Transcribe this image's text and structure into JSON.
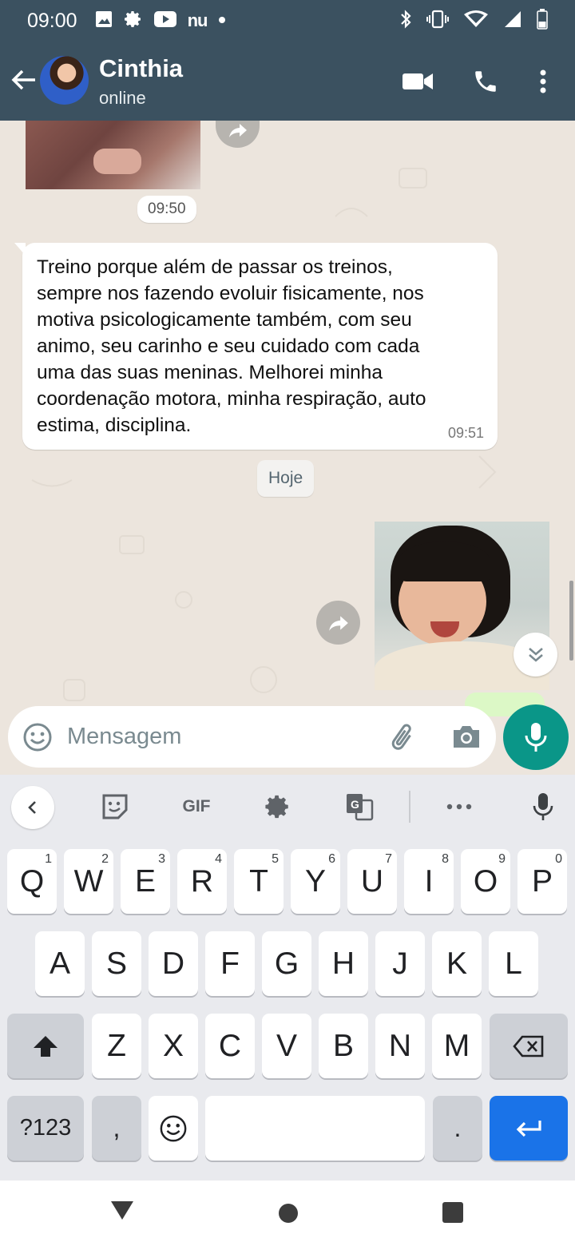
{
  "status_bar": {
    "time": "09:00",
    "left_icons": [
      "gallery-icon",
      "settings-icon",
      "youtube-icon",
      "nubank-icon",
      "dot-icon"
    ],
    "nu_label": "nu",
    "right_icons": [
      "bluetooth-icon",
      "vibrate-icon",
      "wifi-icon",
      "signal-icon",
      "battery-icon"
    ]
  },
  "header": {
    "contact_name": "Cinthia",
    "contact_status": "online",
    "actions": [
      "video-call-icon",
      "voice-call-icon",
      "more-options-icon"
    ]
  },
  "chat": {
    "top_media_time": "09:50",
    "message": {
      "text": "Treino porque além de passar os treinos,\nsempre nos fazendo evoluir fisicamente, nos\nmotiva psicologicamente também, com seu\nanimo, seu carinho e seu cuidado com cada\numa das suas meninas. Melhorei minha\ncoordenação motora, minha respiração, auto\nestima, disciplina.",
      "time": "09:51"
    },
    "date_chip": "Hoje"
  },
  "composer": {
    "placeholder": "Mensagem",
    "value": ""
  },
  "keyboard": {
    "toolbar": {
      "gif_label": "GIF"
    },
    "row1": [
      {
        "label": "Q",
        "hint": "1"
      },
      {
        "label": "W",
        "hint": "2"
      },
      {
        "label": "E",
        "hint": "3"
      },
      {
        "label": "R",
        "hint": "4"
      },
      {
        "label": "T",
        "hint": "5"
      },
      {
        "label": "Y",
        "hint": "6"
      },
      {
        "label": "U",
        "hint": "7"
      },
      {
        "label": "I",
        "hint": "8"
      },
      {
        "label": "O",
        "hint": "9"
      },
      {
        "label": "P",
        "hint": "0"
      }
    ],
    "row2": [
      "A",
      "S",
      "D",
      "F",
      "G",
      "H",
      "J",
      "K",
      "L"
    ],
    "row3": [
      "Z",
      "X",
      "C",
      "V",
      "B",
      "N",
      "M"
    ],
    "symbols_label": "?123",
    "comma_label": ",",
    "period_label": "."
  },
  "colors": {
    "header": "#3b5160",
    "accent": "#0a9688",
    "chat_bg": "#ece5dd",
    "enter_key": "#1a73e8"
  }
}
